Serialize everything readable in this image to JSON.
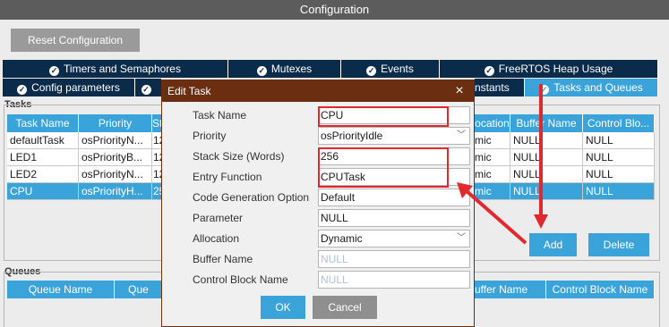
{
  "title": "Configuration",
  "reset_button": "Reset Configuration",
  "tabs_row1": [
    {
      "label": "Timers and Semaphores"
    },
    {
      "label": "Mutexes"
    },
    {
      "label": "Events"
    },
    {
      "label": "FreeRTOS Heap Usage"
    }
  ],
  "tabs_row2": [
    {
      "label": "Config parameters"
    },
    {
      "label": "nstants"
    },
    {
      "label": "Tasks and Queues"
    }
  ],
  "tasks": {
    "group_label": "Tasks",
    "headers": [
      "Task Name",
      "Priority",
      "St",
      "ocation",
      "Buffer Name",
      "Control Blo..."
    ],
    "rows": [
      {
        "name": "defaultTask",
        "priority": "osPriorityN...",
        "stack": "12",
        "alloc": "mic",
        "buffer": "NULL",
        "cb": "NULL",
        "selected": false
      },
      {
        "name": "LED1",
        "priority": "osPriorityB...",
        "stack": "12",
        "alloc": "mic",
        "buffer": "NULL",
        "cb": "NULL",
        "selected": false
      },
      {
        "name": "LED2",
        "priority": "osPriorityN...",
        "stack": "12",
        "alloc": "mic",
        "buffer": "NULL",
        "cb": "NULL",
        "selected": false
      },
      {
        "name": "CPU",
        "priority": "osPriorityH...",
        "stack": "25",
        "alloc": "mic",
        "buffer": "NULL",
        "cb": "NULL",
        "selected": true
      }
    ],
    "add_button": "Add",
    "delete_button": "Delete"
  },
  "queues": {
    "group_label": "Queues",
    "headers": [
      "Queue Name",
      "Que",
      "uffer Name",
      "Control Block Name"
    ]
  },
  "dialog": {
    "title": "Edit Task",
    "close_glyph": "×",
    "fields": [
      {
        "label": "Task Name",
        "value": "CPU",
        "type": "text"
      },
      {
        "label": "Priority",
        "value": "osPriorityIdle",
        "type": "select"
      },
      {
        "label": "Stack Size (Words)",
        "value": "256",
        "type": "text"
      },
      {
        "label": "Entry Function",
        "value": "CPUTask",
        "type": "text"
      },
      {
        "label": "Code Generation Option",
        "value": "Default",
        "type": "text"
      },
      {
        "label": "Parameter",
        "value": "NULL",
        "type": "text"
      },
      {
        "label": "Allocation",
        "value": "Dynamic",
        "type": "select"
      },
      {
        "label": "Buffer Name",
        "value": "NULL",
        "type": "disabled"
      },
      {
        "label": "Control Block Name",
        "value": "NULL",
        "type": "disabled"
      }
    ],
    "ok_button": "OK",
    "cancel_button": "Cancel"
  },
  "colors": {
    "accent": "#3aa3da",
    "dark_tab": "#0a2b4a",
    "dialog_title": "#6b2e10",
    "highlight": "#e0292e"
  }
}
